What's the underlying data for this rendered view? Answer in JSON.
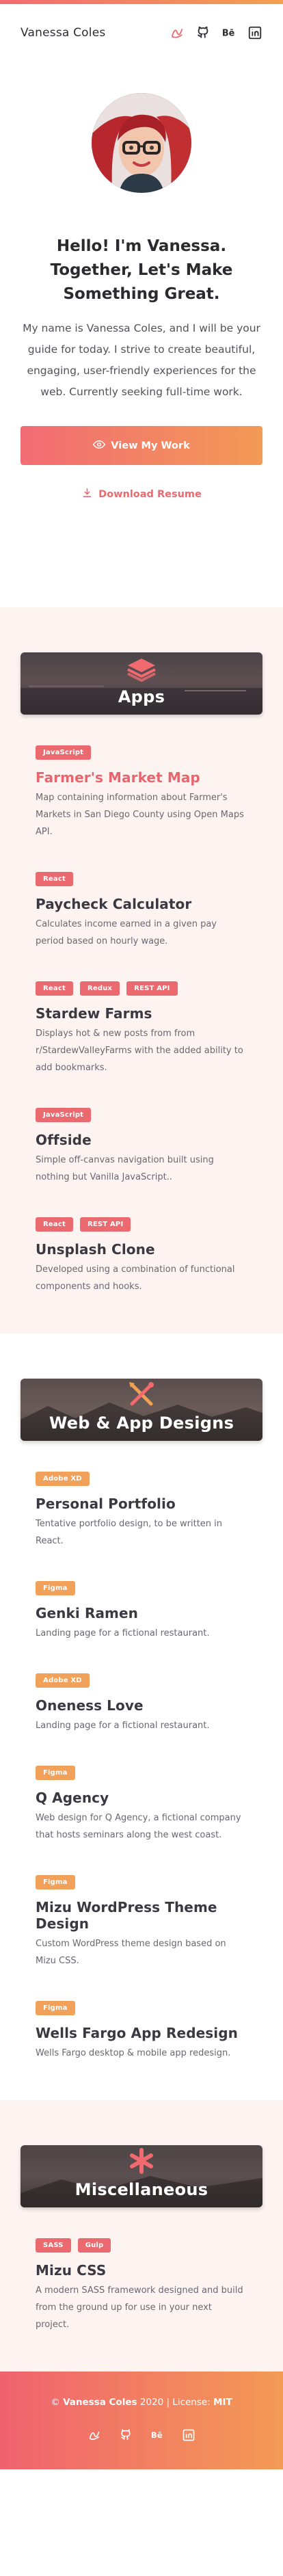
{
  "header": {
    "name": "Vanessa Coles",
    "social": [
      "dribbble-icon",
      "github-icon",
      "behance-icon",
      "linkedin-icon"
    ]
  },
  "hero": {
    "heading": "Hello!  I'm Vanessa.  Together, Let's Make Something Great.",
    "intro": "My name is Vanessa Coles, and I will be your guide for today.  I strive to create beautiful, engaging, user-friendly experiences for the web.  Currently seeking full-time work.",
    "view_work": "View My Work",
    "download_resume": "Download Resume"
  },
  "apps": {
    "title": "Apps",
    "items": [
      {
        "tags": [
          "JavaScript"
        ],
        "title": "Farmer's Market Map",
        "desc": "Map containing information about Farmer's Markets in San Diego County using Open Maps API."
      },
      {
        "tags": [
          "React"
        ],
        "title": "Paycheck Calculator",
        "desc": "Calculates income earned in a given pay period based on hourly wage."
      },
      {
        "tags": [
          "React",
          "Redux",
          "REST API"
        ],
        "title": "Stardew Farms",
        "desc": "Displays hot & new posts from from r/StardewValleyFarms with the added ability to add bookmarks."
      },
      {
        "tags": [
          "JavaScript"
        ],
        "title": "Offside",
        "desc": "Simple off-canvas navigation built using nothing but Vanilla JavaScript.."
      },
      {
        "tags": [
          "React",
          "REST API"
        ],
        "title": "Unsplash Clone",
        "desc": "Developed using a combination of functional components and hooks."
      }
    ]
  },
  "designs": {
    "title": "Web & App Designs",
    "items": [
      {
        "tags": [
          "Adobe XD"
        ],
        "title": "Personal Portfolio",
        "desc": "Tentative portfolio design, to be written in React."
      },
      {
        "tags": [
          "Figma"
        ],
        "title": "Genki Ramen",
        "desc": "Landing page for a fictional restaurant."
      },
      {
        "tags": [
          "Adobe XD"
        ],
        "title": "Oneness Love",
        "desc": "Landing page for a fictional restaurant."
      },
      {
        "tags": [
          "Figma"
        ],
        "title": "Q Agency",
        "desc": "Web design for Q Agency, a fictional company that hosts seminars along the west coast."
      },
      {
        "tags": [
          "Figma"
        ],
        "title": "Mizu WordPress Theme Design",
        "desc": "Custom WordPress theme design based on Mizu CSS."
      },
      {
        "tags": [
          "Figma"
        ],
        "title": "Wells Fargo App Redesign",
        "desc": "Wells Fargo desktop & mobile app redesign."
      }
    ]
  },
  "misc": {
    "title": "Miscellaneous",
    "items": [
      {
        "tags": [
          "SASS",
          "Gulp"
        ],
        "title": "Mizu CSS",
        "desc": "A modern SASS framework designed and build from the ground up for use in your next project."
      }
    ]
  },
  "footer": {
    "copyright": "© ",
    "name": "Vanessa Coles",
    "year": " 2020  |  License: ",
    "license": "MIT"
  },
  "colors": {
    "accent_pink": "#ea6a6f",
    "accent_orange": "#f1a15a",
    "section_bg": "#fdf4f2"
  }
}
